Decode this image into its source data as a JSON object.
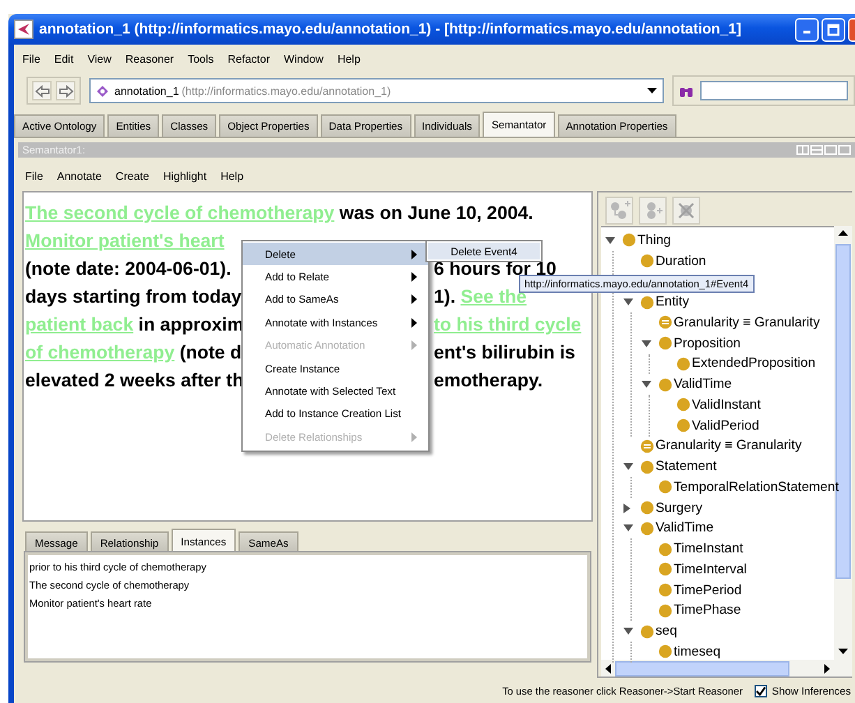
{
  "window": {
    "title": "annotation_1 (http://informatics.mayo.edu/annotation_1) - [http://informatics.mayo.edu/annotation_1]"
  },
  "menu_bar": [
    "File",
    "Edit",
    "View",
    "Reasoner",
    "Tools",
    "Refactor",
    "Window",
    "Help"
  ],
  "toolbar": {
    "ontology_name": "annotation_1",
    "ontology_iri": "(http://informatics.mayo.edu/annotation_1)"
  },
  "tabs": [
    {
      "label": "Active Ontology",
      "selected": false
    },
    {
      "label": "Entities",
      "selected": false
    },
    {
      "label": "Classes",
      "selected": false
    },
    {
      "label": "Object Properties",
      "selected": false
    },
    {
      "label": "Data Properties",
      "selected": false
    },
    {
      "label": "Individuals",
      "selected": false
    },
    {
      "label": "Semantator",
      "selected": true
    },
    {
      "label": "Annotation Properties",
      "selected": false
    }
  ],
  "view": {
    "title": "Semantator1:",
    "menu": [
      "File",
      "Annotate",
      "Create",
      "Highlight",
      "Help"
    ],
    "document": {
      "lines": [
        {
          "full": [
            {
              "text": "The second cycle of chemotherapy",
              "annotated": true
            },
            {
              "text": " was on June 10, 2004.",
              "annotated": false
            }
          ]
        },
        {
          "left": [
            {
              "text": "Monitor patient's heart",
              "annotated": true
            }
          ]
        },
        {
          "left": [
            {
              "text": "(note date: 2004-06-01).",
              "annotated": false
            }
          ],
          "right": [
            {
              "text": "6 hours for 10",
              "annotated": false
            }
          ]
        },
        {
          "left": [
            {
              "text": "days starting from today",
              "annotated": false
            }
          ],
          "right": [
            {
              "text": "1). ",
              "annotated": false
            },
            {
              "text": "See the",
              "annotated": true
            }
          ]
        },
        {
          "left": [
            {
              "text": "patient back",
              "annotated": true
            },
            {
              "text": " in approxim",
              "annotated": false
            }
          ],
          "right": [
            {
              "text": "to his third cycle",
              "annotated": true
            }
          ]
        },
        {
          "left": [
            {
              "text": "of chemotherapy",
              "annotated": true
            },
            {
              "text": " (note d",
              "annotated": false
            }
          ],
          "right": [
            {
              "text": "ent's bilirubin is",
              "annotated": false
            }
          ]
        },
        {
          "left": [
            {
              "text": "elevated 2 weeks after th",
              "annotated": false
            }
          ],
          "right": [
            {
              "text": "emotherapy.",
              "annotated": false
            }
          ]
        }
      ]
    },
    "context_menu": {
      "items": [
        {
          "label": "Delete",
          "selected": true,
          "disabled": false,
          "submenu": true
        },
        {
          "label": "Add to Relate",
          "selected": false,
          "disabled": false,
          "submenu": true
        },
        {
          "label": "Add to SameAs",
          "selected": false,
          "disabled": false,
          "submenu": true
        },
        {
          "label": "Annotate with Instances",
          "selected": false,
          "disabled": false,
          "submenu": true
        },
        {
          "label": "Automatic Annotation",
          "selected": false,
          "disabled": true,
          "submenu": true
        },
        {
          "label": "Create Instance",
          "selected": false,
          "disabled": false,
          "submenu": false
        },
        {
          "label": "Annotate with Selected Text",
          "selected": false,
          "disabled": false,
          "submenu": false
        },
        {
          "label": "Add to Instance Creation List",
          "selected": false,
          "disabled": false,
          "submenu": false
        },
        {
          "label": "Delete Relationships",
          "selected": false,
          "disabled": true,
          "submenu": true
        }
      ]
    },
    "submenu": {
      "items": [
        "Delete Event4"
      ]
    },
    "bottom_tabs": [
      {
        "label": "Message",
        "selected": false
      },
      {
        "label": "Relationship",
        "selected": false
      },
      {
        "label": "Instances",
        "selected": true
      },
      {
        "label": "SameAs",
        "selected": false
      }
    ],
    "instances": [
      "prior to his third cycle of chemotherapy",
      "The second cycle of chemotherapy",
      "Monitor patient's heart rate"
    ]
  },
  "class_tree": [
    {
      "label": "Thing",
      "kind": "class",
      "expanded": true,
      "children": [
        {
          "label": "Duration",
          "kind": "class"
        },
        {
          "kind": "tooltip",
          "text": "http://informatics.mayo.edu/annotation_1#Event4"
        },
        {
          "label": "Entity",
          "kind": "class",
          "expanded": true,
          "children": [
            {
              "label": "Granularity ≡ Granularity",
              "kind": "equivalent"
            },
            {
              "label": "Proposition",
              "kind": "class",
              "expanded": true,
              "children": [
                {
                  "label": "ExtendedProposition",
                  "kind": "class"
                }
              ]
            },
            {
              "label": "ValidTime",
              "kind": "class",
              "expanded": true,
              "children": [
                {
                  "label": "ValidInstant",
                  "kind": "class"
                },
                {
                  "label": "ValidPeriod",
                  "kind": "class"
                }
              ]
            }
          ]
        },
        {
          "label": "Granularity ≡ Granularity",
          "kind": "equivalent"
        },
        {
          "label": "Statement",
          "kind": "class",
          "expanded": true,
          "children": [
            {
              "label": "TemporalRelationStatement",
              "kind": "class"
            }
          ]
        },
        {
          "label": "Surgery",
          "kind": "class",
          "expanded": false
        },
        {
          "label": "ValidTime",
          "kind": "class",
          "expanded": true,
          "children": [
            {
              "label": "TimeInstant",
              "kind": "class"
            },
            {
              "label": "TimeInterval",
              "kind": "class"
            },
            {
              "label": "TimePeriod",
              "kind": "class"
            },
            {
              "label": "TimePhase",
              "kind": "class"
            }
          ]
        },
        {
          "label": "seq",
          "kind": "class",
          "expanded": true,
          "children": [
            {
              "label": "timeseq",
              "kind": "class"
            }
          ]
        }
      ]
    }
  ],
  "status_bar": {
    "message": "To use the reasoner click Reasoner->Start Reasoner",
    "show_inferences": {
      "label": "Show Inferences",
      "checked": true
    }
  }
}
